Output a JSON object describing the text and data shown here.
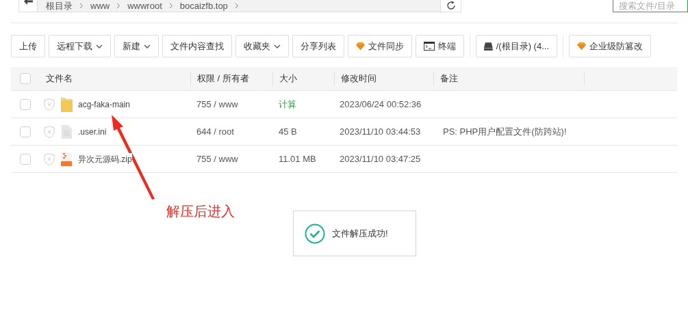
{
  "breadcrumb": [
    "根目录",
    "www",
    "wwwroot",
    "bocaizfb.top"
  ],
  "search": {
    "placeholder": "搜索文件/目录"
  },
  "toolbar": [
    {
      "label": "上传",
      "kind": "plain"
    },
    {
      "label": "远程下载",
      "kind": "dropdown"
    },
    {
      "label": "新建",
      "kind": "dropdown"
    },
    {
      "label": "文件内容查找",
      "kind": "plain"
    },
    {
      "label": "收藏夹",
      "kind": "dropdown"
    },
    {
      "label": "分享列表",
      "kind": "plain"
    },
    {
      "label": "文件同步",
      "kind": "gem"
    },
    {
      "label": "终端",
      "kind": "terminal"
    },
    {
      "label": "/(根目录) (4...",
      "kind": "disk"
    },
    {
      "label": "企业级防篡改",
      "kind": "gem"
    }
  ],
  "table": {
    "all_checked": false,
    "columns": [
      "文件名",
      "权限 / 所有者",
      "大小",
      "修改时间",
      "备注"
    ],
    "rows": [
      {
        "name": "acg-faka-main",
        "kind": "folder",
        "perm": "755 / www",
        "size": "计算",
        "size_is_link": true,
        "mtime": "2023/06/24 00:52:36",
        "checked": false
      },
      {
        "name": ".user.ini",
        "kind": "file",
        "perm": "644 / root",
        "size": "45 B",
        "size_is_link": false,
        "mtime": "2023/11/10 03:44:53",
        "note": "PS: PHP用户配置文件(防跨站)!",
        "checked": false
      },
      {
        "name": "异次元源码.zip",
        "kind": "zip",
        "perm": "755 / www",
        "size": "11.01 MB",
        "size_is_link": false,
        "mtime": "2023/11/10 03:47:25",
        "checked": false
      }
    ]
  },
  "annotation": "解压后进入",
  "toast": "文件解压成功!"
}
